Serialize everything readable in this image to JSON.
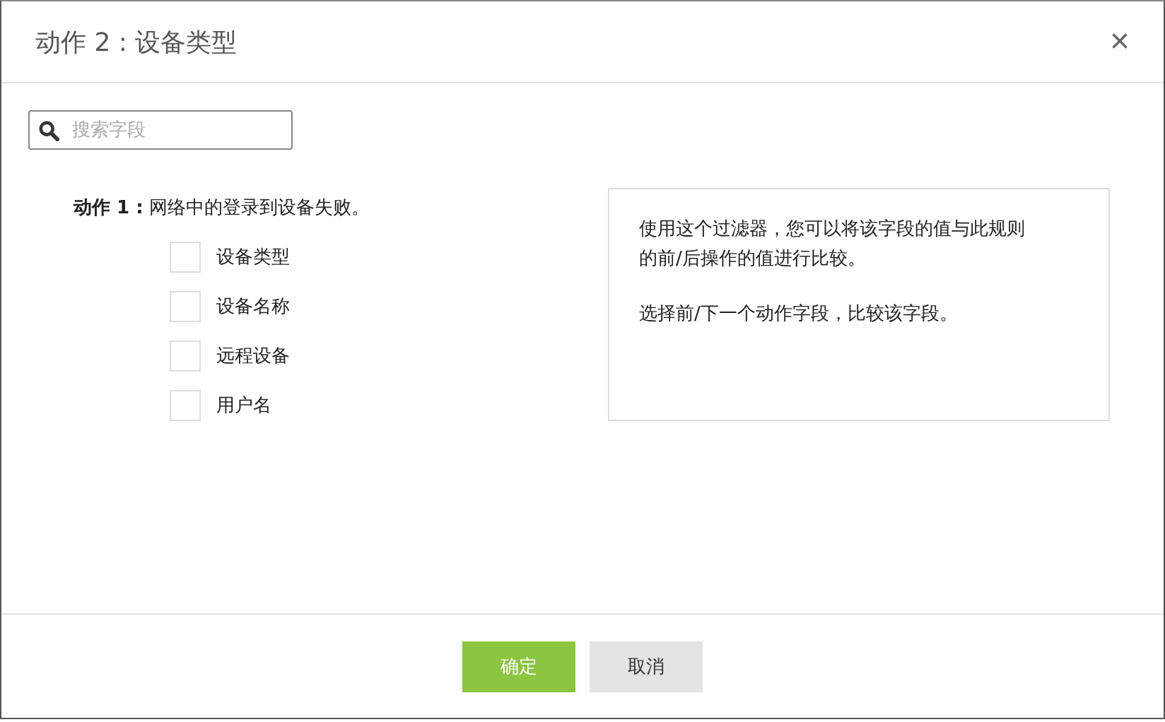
{
  "dialog": {
    "title": "动作 2 : 设备类型",
    "close": "×"
  },
  "search": {
    "placeholder": "搜索字段"
  },
  "action_label": "**动作 1 :** 网络中的登录到设备失败。",
  "fields": [
    {
      "label": "设备类型",
      "checked": false
    },
    {
      "label": "设备名称",
      "checked": false
    },
    {
      "label": "远程设备",
      "checked": false
    },
    {
      "label": "用户名",
      "checked": false
    }
  ],
  "info": [
    "使用这个过滤器，您可以将该字段的值与此规则的前/后操作的值进行比较。",
    "选择前/下一个动作字段，比较该字段。"
  ],
  "buttons": [
    {
      "label": "确定",
      "kind": "primary"
    },
    {
      "label": "取消",
      "kind": "secondary"
    }
  ]
}
